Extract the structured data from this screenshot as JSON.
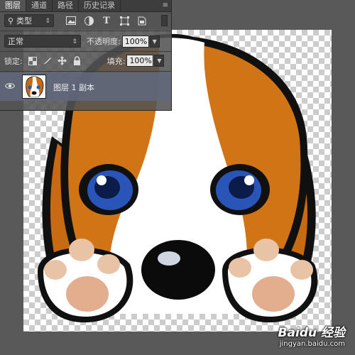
{
  "panel": {
    "tabs": [
      {
        "label": "图层"
      },
      {
        "label": "通道"
      },
      {
        "label": "路径"
      },
      {
        "label": "历史记录"
      }
    ],
    "filter": {
      "value": "类型"
    },
    "blend_mode": {
      "value": "正常"
    },
    "opacity": {
      "label": "不透明度:",
      "value": "100%"
    },
    "lock_label": "锁定:",
    "fill": {
      "label": "填充:",
      "value": "100%"
    },
    "layers": [
      {
        "name": "图层 1 副本",
        "visible": true
      }
    ]
  },
  "watermark": {
    "logo": "Baidu 经验",
    "url": "jingyan.baidu.com"
  }
}
